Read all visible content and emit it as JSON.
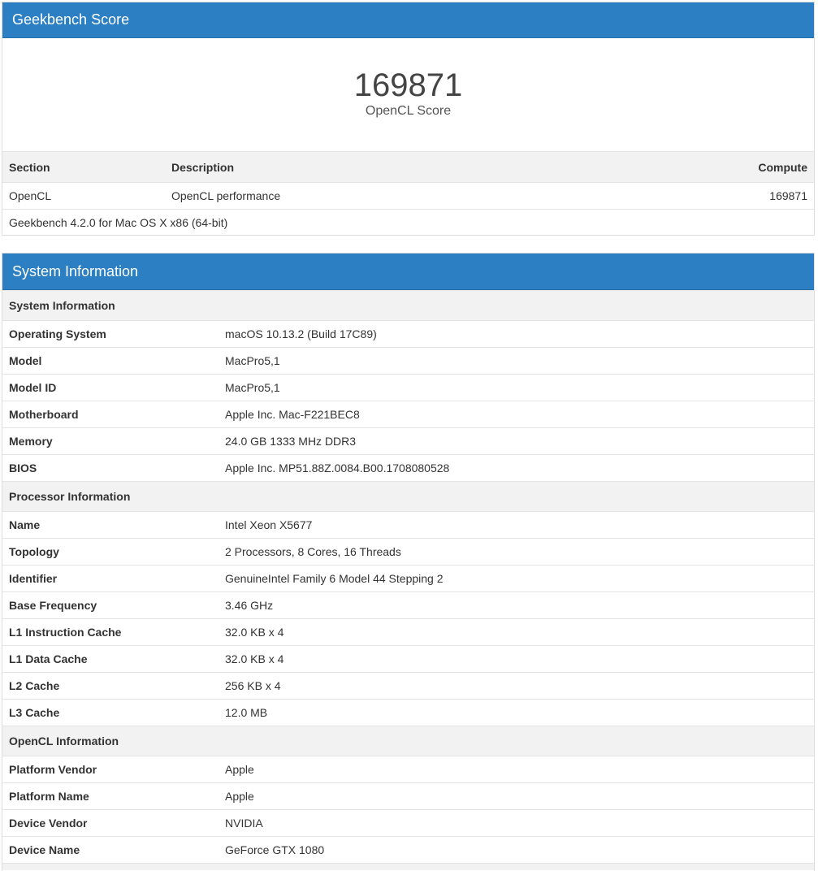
{
  "score_panel": {
    "title": "Geekbench Score",
    "score_value": "169871",
    "score_label": "OpenCL Score",
    "table": {
      "headers": [
        "Section",
        "Description",
        "Compute"
      ],
      "rows": [
        [
          "OpenCL",
          "OpenCL performance",
          "169871"
        ]
      ],
      "footer": "Geekbench 4.2.0 for Mac OS X x86 (64-bit)"
    }
  },
  "system_panel": {
    "title": "System Information",
    "groups": [
      {
        "label": "System Information",
        "rows": [
          [
            "Operating System",
            "macOS 10.13.2 (Build 17C89)"
          ],
          [
            "Model",
            "MacPro5,1"
          ],
          [
            "Model ID",
            "MacPro5,1"
          ],
          [
            "Motherboard",
            "Apple Inc. Mac-F221BEC8"
          ],
          [
            "Memory",
            "24.0 GB 1333 MHz DDR3"
          ],
          [
            "BIOS",
            "Apple Inc. MP51.88Z.0084.B00.1708080528"
          ]
        ]
      },
      {
        "label": "Processor Information",
        "rows": [
          [
            "Name",
            "Intel Xeon X5677"
          ],
          [
            "Topology",
            "2 Processors, 8 Cores, 16 Threads"
          ],
          [
            "Identifier",
            "GenuineIntel Family 6 Model 44 Stepping 2"
          ],
          [
            "Base Frequency",
            "3.46 GHz"
          ],
          [
            "L1 Instruction Cache",
            "32.0 KB x 4"
          ],
          [
            "L1 Data Cache",
            "32.0 KB x 4"
          ],
          [
            "L2 Cache",
            "256 KB x 4"
          ],
          [
            "L3 Cache",
            "12.0 MB"
          ]
        ]
      },
      {
        "label": "OpenCL Information",
        "rows": [
          [
            "Platform Vendor",
            "Apple"
          ],
          [
            "Platform Name",
            "Apple"
          ],
          [
            "Device Vendor",
            "NVIDIA"
          ],
          [
            "Device Name",
            "GeForce GTX 1080"
          ]
        ]
      }
    ]
  },
  "colors": {
    "heading_bg": "#2b7fc2",
    "group_bg": "#f2f2f2",
    "border": "#e4e4e4"
  }
}
